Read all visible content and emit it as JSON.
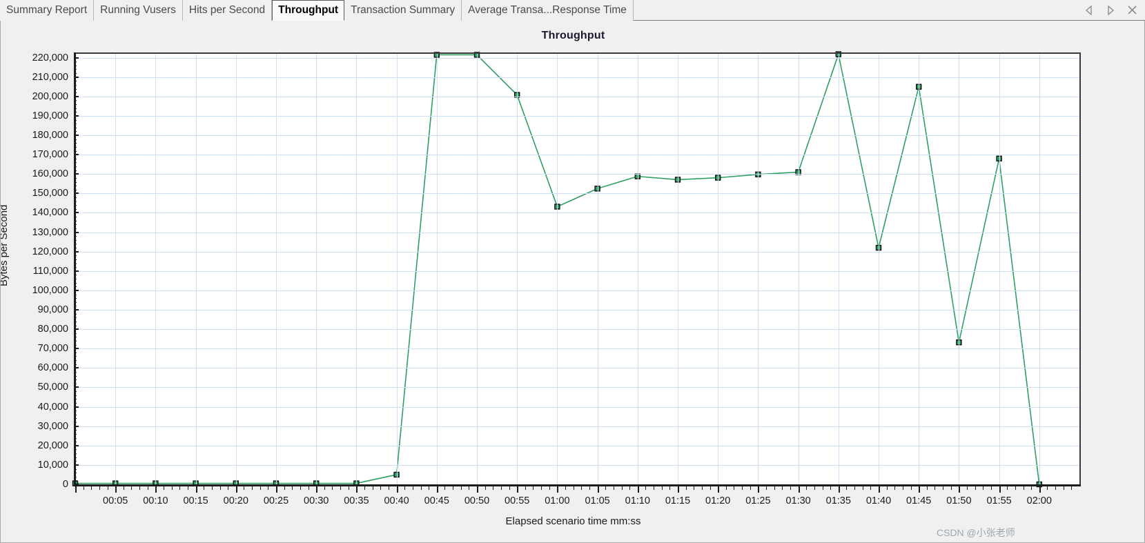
{
  "window": {
    "tabs": [
      {
        "label": "Summary Report",
        "active": false
      },
      {
        "label": "Running Vusers",
        "active": false
      },
      {
        "label": "Hits per Second",
        "active": false
      },
      {
        "label": "Throughput",
        "active": true
      },
      {
        "label": "Transaction Summary",
        "active": false
      },
      {
        "label": "Average Transa...Response Time",
        "active": false
      }
    ],
    "nav": {
      "prev_label": "◁",
      "next_label": "▷",
      "close_label": "✕"
    }
  },
  "watermark": "CSDN @小张老师",
  "colors": {
    "series": "#2e9e63",
    "marker_fill": "#2e9e63",
    "marker_stroke": "#111111",
    "grid": "#cfe0f5",
    "axis": "#1c1c1c",
    "panel_bg": "#f0f0f0",
    "plot_bg": "#ffffff",
    "title": "#1a1a2e",
    "tab_active_bg": "#fafafa"
  },
  "chart_data": {
    "type": "line",
    "title": "Throughput",
    "xlabel": "Elapsed scenario time mm:ss",
    "ylabel": "Bytes per Second",
    "grid": true,
    "legend": null,
    "ylim": [
      0,
      222000
    ],
    "ytick_step": 10000,
    "yticks": [
      0,
      10000,
      20000,
      30000,
      40000,
      50000,
      60000,
      70000,
      80000,
      90000,
      100000,
      110000,
      120000,
      130000,
      140000,
      150000,
      160000,
      170000,
      180000,
      190000,
      200000,
      210000,
      220000
    ],
    "ytick_labels": [
      "0",
      "10,000",
      "20,000",
      "30,000",
      "40,000",
      "50,000",
      "60,000",
      "70,000",
      "80,000",
      "90,000",
      "100,000",
      "110,000",
      "120,000",
      "130,000",
      "140,000",
      "150,000",
      "160,000",
      "170,000",
      "180,000",
      "190,000",
      "200,000",
      "210,000",
      "220,000"
    ],
    "xtick_labels": [
      "00:05",
      "00:10",
      "00:15",
      "00:20",
      "00:25",
      "00:30",
      "00:35",
      "00:40",
      "00:45",
      "00:50",
      "00:55",
      "01:00",
      "01:05",
      "01:10",
      "01:15",
      "01:20",
      "01:25",
      "01:30",
      "01:35",
      "01:40",
      "01:45",
      "01:50",
      "01:55",
      "02:00"
    ],
    "xlim_seconds": [
      0,
      125
    ],
    "xtick_step_seconds": 5,
    "series": [
      {
        "name": "Throughput",
        "color": "#2e9e63",
        "x": [
          "00:00",
          "00:05",
          "00:10",
          "00:15",
          "00:20",
          "00:25",
          "00:30",
          "00:35",
          "00:40",
          "00:45",
          "00:50",
          "00:55",
          "01:00",
          "01:05",
          "01:10",
          "01:15",
          "01:20",
          "01:25",
          "01:30",
          "01:35",
          "01:40",
          "01:45",
          "01:50",
          "01:55",
          "02:00"
        ],
        "values": [
          500,
          500,
          500,
          500,
          500,
          500,
          500,
          500,
          5000,
          221500,
          221500,
          200800,
          143200,
          152500,
          158800,
          157100,
          158100,
          159800,
          161000,
          221800,
          122000,
          205000,
          73200,
          168000,
          0
        ]
      }
    ]
  }
}
